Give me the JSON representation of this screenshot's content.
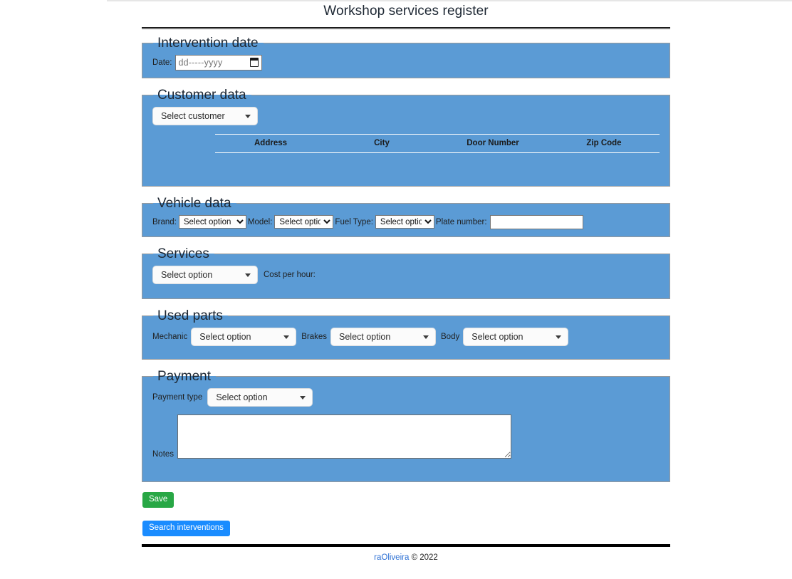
{
  "header": {
    "title": "Workshop services register"
  },
  "sections": {
    "intervention": {
      "legend": "Intervention date",
      "date_label": "Date:",
      "date_value": "",
      "date_placeholder": "dd-----yyyy",
      "calendar_icon": "calendar-icon"
    },
    "customer": {
      "legend": "Customer data",
      "select_customer": "Select customer",
      "columns": [
        "Address",
        "City",
        "Door Number",
        "Zip Code"
      ],
      "rows": []
    },
    "vehicle": {
      "legend": "Vehicle data",
      "brand_label": "Brand:",
      "brand_value": "Select option",
      "model_label": "Model:",
      "model_value": "Select option",
      "fuel_label": "Fuel Type:",
      "fuel_value": "Select option",
      "plate_label": "Plate number:",
      "plate_value": ""
    },
    "services": {
      "legend": "Services",
      "service_value": "Select option",
      "cost_label": "Cost per hour:",
      "cost_value": ""
    },
    "used_parts": {
      "legend": "Used parts",
      "mechanic_label": "Mechanic",
      "mechanic_value": "Select option",
      "brakes_label": "Brakes",
      "brakes_value": "Select option",
      "body_label": "Body",
      "body_value": "Select option"
    },
    "payment": {
      "legend": "Payment",
      "payment_type_label": "Payment type",
      "payment_type_value": "Select option",
      "notes_label": "Notes",
      "notes_value": ""
    }
  },
  "actions": {
    "save_label": "Save",
    "search_label": "Search interventions",
    "save_color": "#28a745",
    "search_color": "#1a8cff"
  },
  "footer": {
    "author": "raOliveira",
    "copyright": "© 2022"
  },
  "theme": {
    "panel_blue": "#5b9bd5",
    "link_blue": "#2b6fd4",
    "text_dark": "#212529"
  }
}
